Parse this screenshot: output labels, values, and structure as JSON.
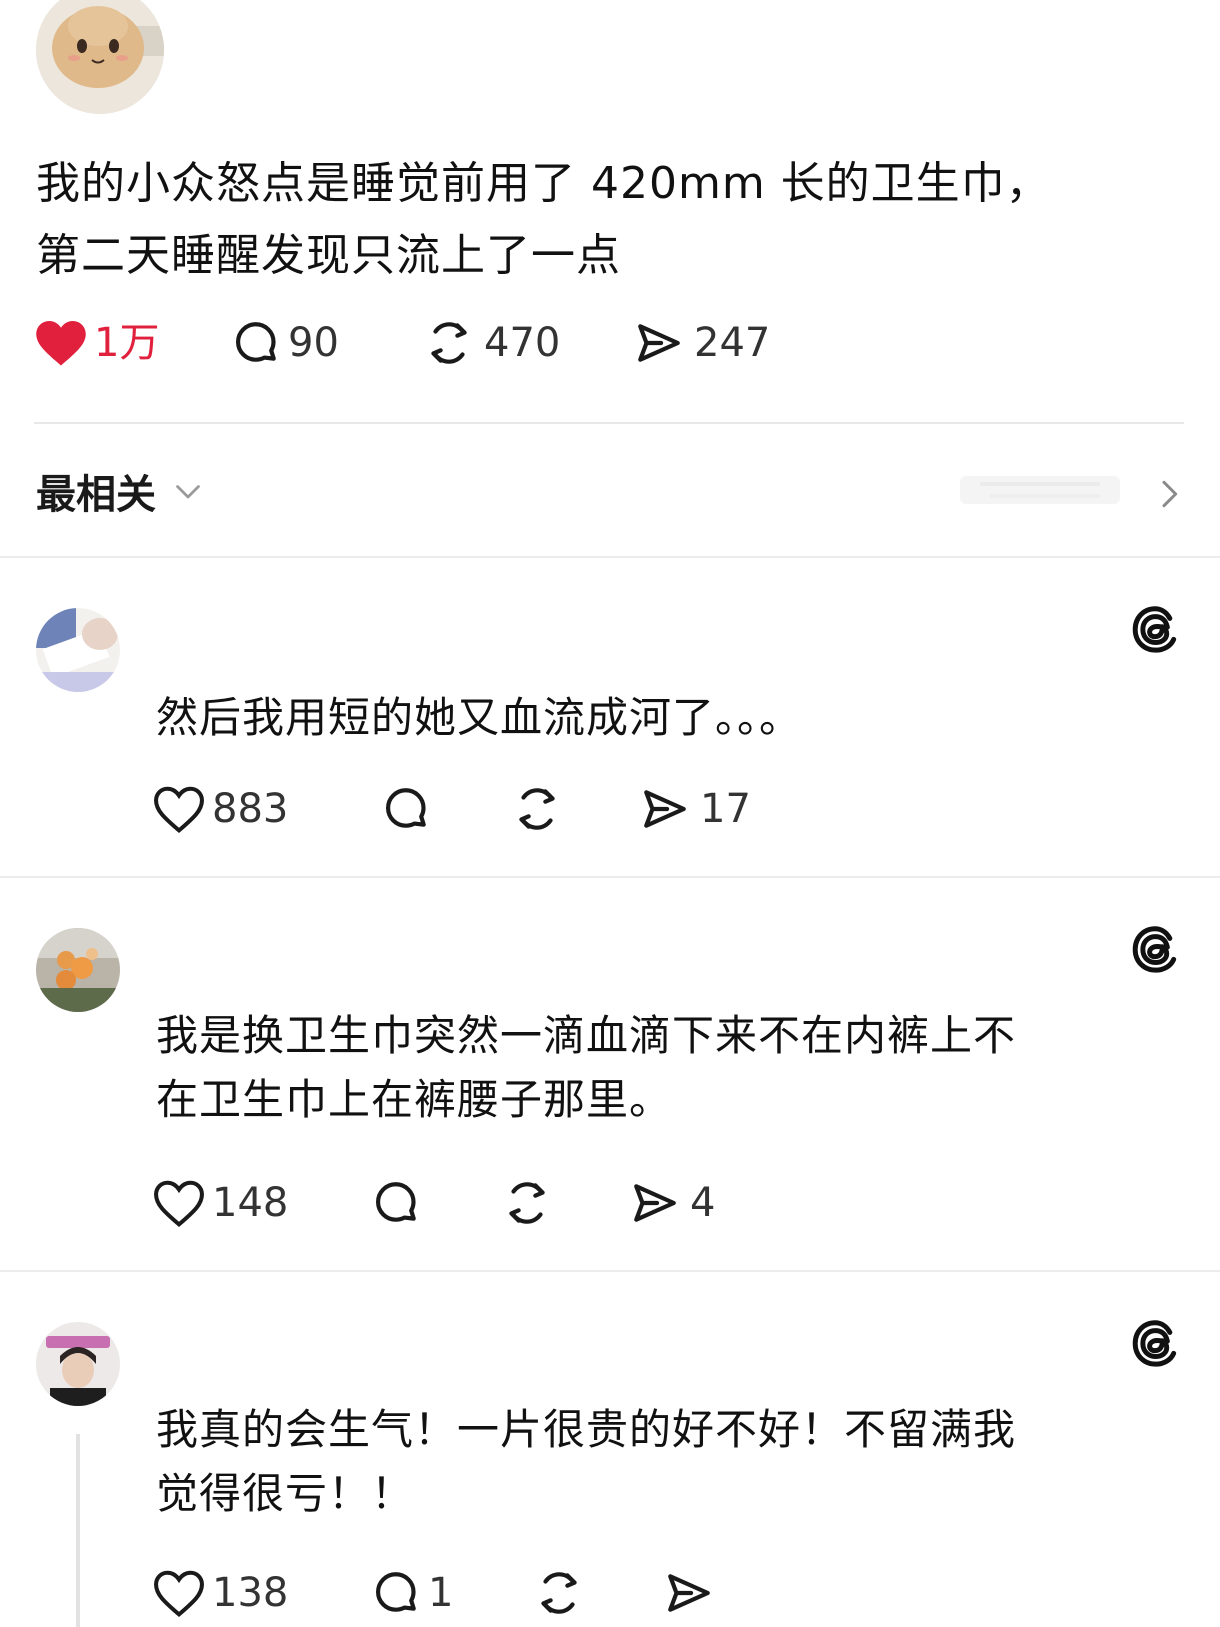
{
  "post": {
    "text_line1": "我的小众怒点是睡觉前用了 420mm 长的卫生巾，",
    "text_line2": "第二天睡醒发现只流上了一点",
    "likes": "1万",
    "comments": "90",
    "reposts": "470",
    "shares": "247"
  },
  "sort": {
    "label": "最相关"
  },
  "comments": [
    {
      "text_line1": "然后我用短的她又血流成河了。。。",
      "text_line2": "",
      "likes": "883",
      "replies": "",
      "reposts": "",
      "shares": "17"
    },
    {
      "text_line1": "我是换卫生巾突然一滴血滴下来不在内裤上不",
      "text_line2": "在卫生巾上在裤腰子那里。",
      "likes": "148",
      "replies": "",
      "reposts": "",
      "shares": "4"
    },
    {
      "text_line1": "我真的会生气！一片很贵的好不好！不留满我",
      "text_line2": "觉得很亏！！",
      "likes": "138",
      "replies": "1",
      "reposts": "",
      "shares": ""
    }
  ],
  "icons": {
    "like_filled": "heart-filled-icon",
    "like": "heart-icon",
    "comment": "comment-bubble-icon",
    "repost": "repost-icon",
    "share": "send-icon",
    "threads": "threads-logo-icon",
    "chevron_down": "chevron-down-icon",
    "chevron_right": "chevron-right-icon"
  },
  "colors": {
    "like_red": "#e0203c",
    "text": "#111111",
    "divider": "#e8e8e8"
  }
}
